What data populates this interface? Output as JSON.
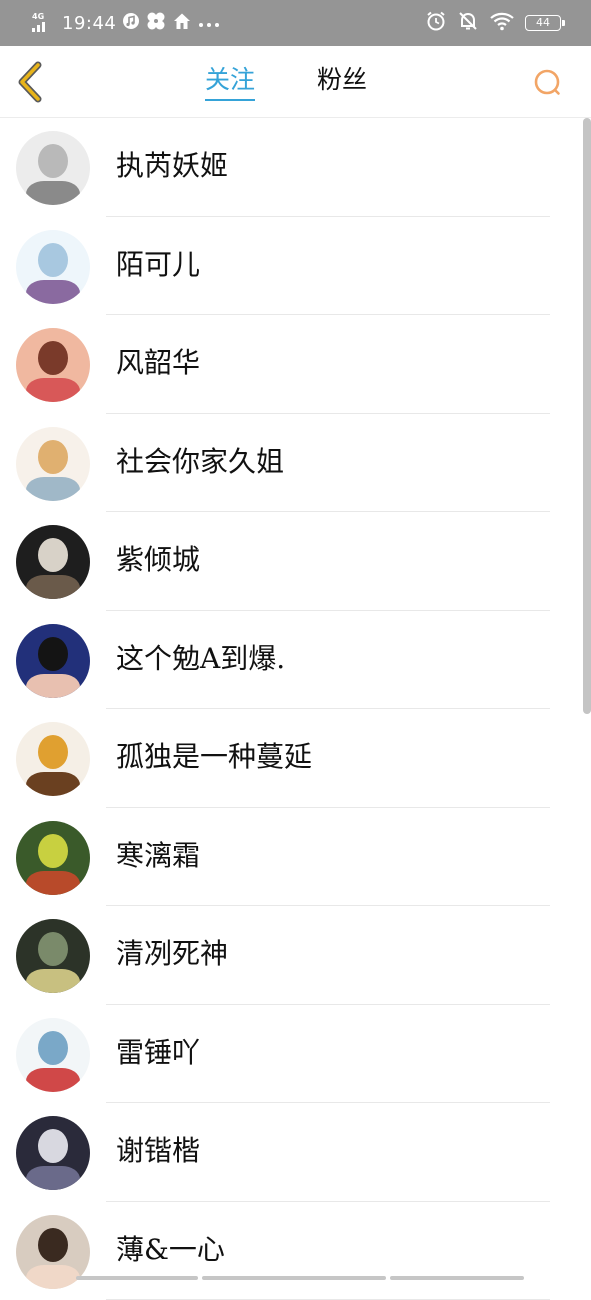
{
  "status_bar": {
    "network": "4G",
    "time": "19:44",
    "battery": "44",
    "icons": [
      "signal-icon",
      "music-note-icon",
      "pinwheel-icon",
      "home-icon",
      "more-dots-icon",
      "alarm-icon",
      "mute-bell-icon",
      "wifi-icon",
      "battery-icon"
    ]
  },
  "nav": {
    "tabs": [
      {
        "label": "关注",
        "active": true
      },
      {
        "label": "粉丝",
        "active": false
      }
    ],
    "back_icon": "chevron-left-icon",
    "search_icon": "search-icon",
    "colors": {
      "active_tab": "#35a3d8",
      "back_icon": "#e0a818",
      "search_icon": "#f0a060"
    }
  },
  "users": [
    {
      "name": "执芮妖姬",
      "avatar": [
        "#ececec",
        "#b9b9b9",
        "#8a8a8a"
      ]
    },
    {
      "name": "陌可儿",
      "avatar": [
        "#eef6fb",
        "#a8c8e0",
        "#8a6aa0"
      ]
    },
    {
      "name": "风韶华",
      "avatar": [
        "#f0b8a0",
        "#7a3a2a",
        "#d85858"
      ]
    },
    {
      "name": "社会你家久姐",
      "avatar": [
        "#f7f1ea",
        "#e0b070",
        "#a0b8c8"
      ]
    },
    {
      "name": "紫倾城",
      "avatar": [
        "#1e1e1e",
        "#d8d2c8",
        "#6a5a4a"
      ]
    },
    {
      "name": "这个勉A到爆.",
      "avatar": [
        "#22307a",
        "#141414",
        "#e8c0b0"
      ]
    },
    {
      "name": "孤独是一种蔓延",
      "avatar": [
        "#f5efe6",
        "#e0a030",
        "#6a4020"
      ]
    },
    {
      "name": "寒漓霜",
      "avatar": [
        "#3a5a2a",
        "#c8d040",
        "#b84a2a"
      ]
    },
    {
      "name": "清冽死神",
      "avatar": [
        "#2c3328",
        "#7a8a6a",
        "#c8c080"
      ]
    },
    {
      "name": "雷锤吖",
      "avatar": [
        "#f2f6f8",
        "#7aa8c8",
        "#d04848"
      ]
    },
    {
      "name": "谢锴楷",
      "avatar": [
        "#2a2a3a",
        "#d8d8e0",
        "#6a6a8a"
      ]
    },
    {
      "name": "薄&一心",
      "avatar": [
        "#d8ccc0",
        "#3a2a20",
        "#f0d8c8"
      ]
    }
  ]
}
